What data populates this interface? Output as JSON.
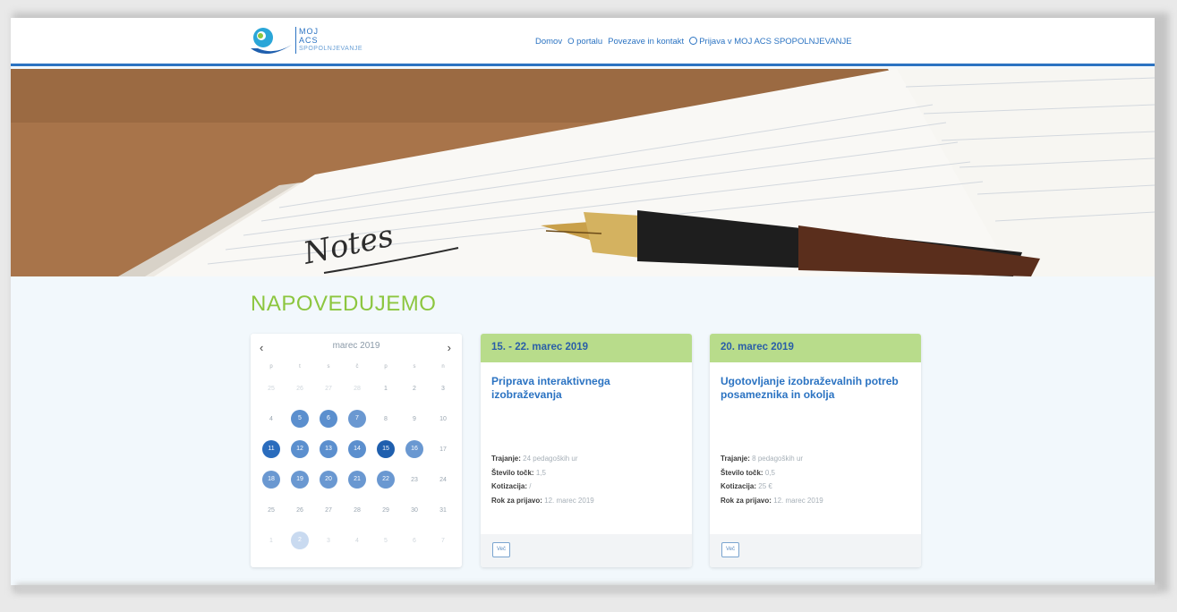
{
  "header": {
    "logo_line1": "MOJ",
    "logo_line2": "ACS",
    "logo_line3": "SPOPOLNJEVANJE",
    "nav": [
      "Domov",
      "O portalu",
      "Povezave in kontakt"
    ],
    "login_label": "Prijava v MOJ ACS SPOPOLNJEVANJE"
  },
  "hero": {
    "handwriting": "Notes"
  },
  "section_title": "NAPOVEDUJEMO",
  "calendar": {
    "prev": "‹",
    "next": "›",
    "month": "marec 2019",
    "weekdays": [
      "p",
      "t",
      "s",
      "č",
      "p",
      "s",
      "n"
    ],
    "weeks": [
      [
        {
          "d": "25",
          "m": true
        },
        {
          "d": "26",
          "m": true
        },
        {
          "d": "27",
          "m": true
        },
        {
          "d": "28",
          "m": true
        },
        {
          "d": "1"
        },
        {
          "d": "2"
        },
        {
          "d": "3"
        }
      ],
      [
        {
          "d": "4"
        },
        {
          "d": "5",
          "c": "#5b8fce"
        },
        {
          "d": "6",
          "c": "#5b8fce"
        },
        {
          "d": "7",
          "c": "#6a98d1"
        },
        {
          "d": "8"
        },
        {
          "d": "9"
        },
        {
          "d": "10"
        }
      ],
      [
        {
          "d": "11",
          "c": "#2a6cbd"
        },
        {
          "d": "12",
          "c": "#5b8fce"
        },
        {
          "d": "13",
          "c": "#5b8fce"
        },
        {
          "d": "14",
          "c": "#5b8fce"
        },
        {
          "d": "15",
          "c": "#1f5fae"
        },
        {
          "d": "16",
          "c": "#6a98d1"
        },
        {
          "d": "17"
        }
      ],
      [
        {
          "d": "18",
          "c": "#6a98d1"
        },
        {
          "d": "19",
          "c": "#6a98d1"
        },
        {
          "d": "20",
          "c": "#6a98d1"
        },
        {
          "d": "21",
          "c": "#6a98d1"
        },
        {
          "d": "22",
          "c": "#6a98d1"
        },
        {
          "d": "23"
        },
        {
          "d": "24"
        }
      ],
      [
        {
          "d": "25"
        },
        {
          "d": "26"
        },
        {
          "d": "27"
        },
        {
          "d": "28"
        },
        {
          "d": "29"
        },
        {
          "d": "30"
        },
        {
          "d": "31"
        }
      ],
      [
        {
          "d": "1",
          "m": true
        },
        {
          "d": "2",
          "c": "#c9daf0"
        },
        {
          "d": "3",
          "m": true
        },
        {
          "d": "4",
          "m": true
        },
        {
          "d": "5",
          "m": true
        },
        {
          "d": "6",
          "m": true
        },
        {
          "d": "7",
          "m": true
        }
      ]
    ]
  },
  "events": [
    {
      "date": "15. - 22. marec 2019",
      "title": "Priprava interaktivnega izobraževanja",
      "trajanje_label": "Trajanje:",
      "trajanje": "24 pedagoških ur",
      "tocke_label": "Število točk:",
      "tocke": "1,5",
      "kotizacija_label": "Kotizacija:",
      "kotizacija": "/",
      "rok_label": "Rok za prijavo:",
      "rok": "12. marec 2019",
      "button": "Več"
    },
    {
      "date": "20. marec 2019",
      "title": "Ugotovljanje izobraževalnih potreb posameznika in okolja",
      "trajanje_label": "Trajanje:",
      "trajanje": "8 pedagoških ur",
      "tocke_label": "Število točk:",
      "tocke": "0,5",
      "kotizacija_label": "Kotizacija:",
      "kotizacija": "25 €",
      "rok_label": "Rok za prijavo:",
      "rok": "12. marec 2019",
      "button": "Več"
    }
  ],
  "colors": {
    "accent_blue": "#2b73c2",
    "title_green": "#8cc63f",
    "card_header_green": "#b8dc8b"
  }
}
